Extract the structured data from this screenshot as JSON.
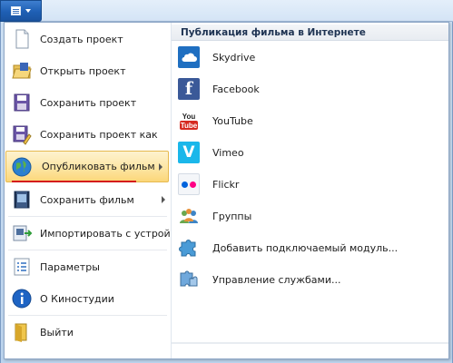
{
  "window": {
    "app_button_icon": "document-menu-icon"
  },
  "menu": {
    "items": [
      {
        "label": "Создать проект",
        "icon": "new-project-icon"
      },
      {
        "label": "Открыть проект",
        "icon": "open-folder-icon"
      },
      {
        "label": "Сохранить проект",
        "icon": "save-icon"
      },
      {
        "label": "Сохранить проект как",
        "icon": "save-as-icon"
      },
      {
        "label": "Опубликовать фильм",
        "icon": "globe-publish-icon"
      },
      {
        "label": "Сохранить фильм",
        "icon": "film-save-icon"
      },
      {
        "label": "Импортировать с устройства",
        "icon": "import-device-icon"
      },
      {
        "label": "Параметры",
        "icon": "options-icon"
      },
      {
        "label": "О Киностудии",
        "icon": "info-icon"
      },
      {
        "label": "Выйти",
        "icon": "exit-icon"
      }
    ]
  },
  "submenu": {
    "title": "Публикация фильма в Интернете",
    "items": [
      {
        "label": "Skydrive",
        "icon": "skydrive-icon"
      },
      {
        "label": "Facebook",
        "icon": "facebook-icon"
      },
      {
        "label": "YouTube",
        "icon": "youtube-icon"
      },
      {
        "label": "Vimeo",
        "icon": "vimeo-icon"
      },
      {
        "label": "Flickr",
        "icon": "flickr-icon"
      },
      {
        "label": "Группы",
        "icon": "groups-icon"
      },
      {
        "label": "Добавить подключаемый модуль...",
        "icon": "plugin-add-icon"
      },
      {
        "label": "Управление службами...",
        "icon": "manage-services-icon"
      }
    ]
  },
  "colors": {
    "highlight": "#fbd779",
    "accent_underline": "#d41c1c",
    "brand_blue": "#1e5fb4"
  }
}
